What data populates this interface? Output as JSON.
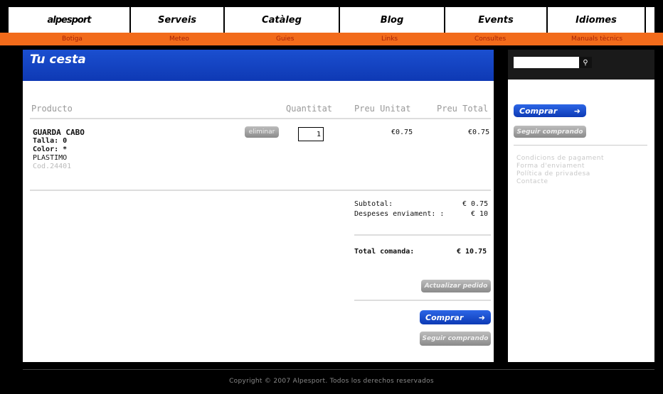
{
  "nav": {
    "logo": "alpesport",
    "items": [
      "Serveis",
      "Catàleg",
      "Blog",
      "Events",
      "Idiomes"
    ]
  },
  "subnav": {
    "items": [
      "Botiga",
      "Meteo",
      "Guies",
      "Links",
      "Consultes",
      "Manuals tècnics"
    ]
  },
  "cart": {
    "title": "Tu cesta",
    "headers": {
      "product": "Producto",
      "quantity": "Quantitat",
      "unit_price": "Preu Unitat",
      "total_price": "Preu Total"
    },
    "item": {
      "name": "GUARDA CABO",
      "size": "Talla: 0",
      "color": "Color: *",
      "brand": "PLASTIMO",
      "code": "Cod.24401",
      "remove_label": "eliminar",
      "quantity": "1",
      "unit_price": "€0.75",
      "total_price": "€0.75"
    },
    "subtotal_label": "Subtotal:",
    "subtotal_value": "€ 0.75",
    "shipping_label": "Despeses enviament: :",
    "shipping_value": "€ 10",
    "total_label": "Total comanda:",
    "total_value": "€ 10.75",
    "update_label": "Actualizar pedido",
    "buy_label": "Comprar",
    "continue_label": "Seguir comprando"
  },
  "sidebar": {
    "search_value": "",
    "search_icon": "search-icon",
    "buy_label": "Comprar",
    "continue_label": "Seguir comprando",
    "links": [
      "Condicions de pagament",
      "Forma d'enviament",
      "Política de privadesa",
      "Contacte"
    ]
  },
  "footer": {
    "text": "Copyright © 2007 Alpesport. Todos los derechos reservados"
  },
  "colors": {
    "accent_blue": "#1b4fd0",
    "orange": "#f26b1b",
    "logo_red": "#e8242a"
  }
}
